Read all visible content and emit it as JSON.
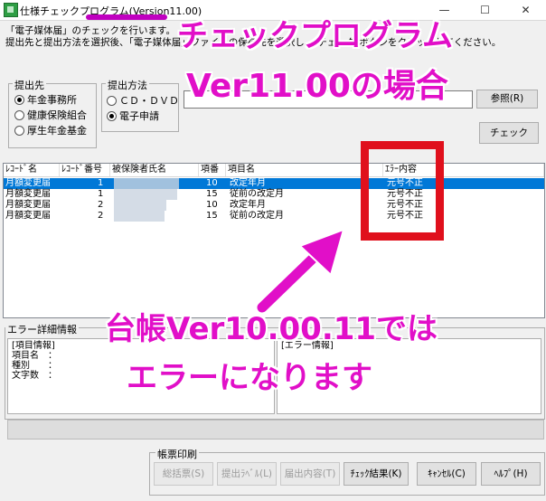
{
  "window": {
    "title": "仕様チェックプログラム(Version11.00)",
    "minimize": "—",
    "maximize": "☐",
    "close": "✕"
  },
  "instructions": {
    "line1": "「電子媒体届」のチェックを行います。",
    "line2": "提出先と提出方法を選択後、「電子媒体届」ファイルの保存先を選択し、[チェック]ボタンをクリックしてください。"
  },
  "submit_to": {
    "label": "提出先",
    "options": [
      "年金事務所",
      "健康保険組合",
      "厚生年金基金"
    ],
    "selected": 0
  },
  "method": {
    "label": "提出方法",
    "options": [
      "ＣＤ・ＤＶＤ",
      "電子申請"
    ],
    "selected": 1
  },
  "path": {
    "value": ""
  },
  "buttons": {
    "browse": "参照(R)",
    "check": "チェック"
  },
  "table": {
    "columns": [
      "ﾚｺｰﾄﾞ名",
      "ﾚｺｰﾄﾞ番号",
      "被保険者氏名",
      "項番",
      "項目名",
      "ｴﾗｰ内容"
    ],
    "rows": [
      {
        "record": "月額変更届",
        "no": "1",
        "name": "",
        "item_no": "10",
        "item": "改定年月",
        "error": "元号不正"
      },
      {
        "record": "月額変更届",
        "no": "1",
        "name": "",
        "item_no": "15",
        "item": "従前の改定月",
        "error": "元号不正"
      },
      {
        "record": "月額変更届",
        "no": "2",
        "name": "",
        "item_no": "10",
        "item": "改定年月",
        "error": "元号不正"
      },
      {
        "record": "月額変更届",
        "no": "2",
        "name": "",
        "item_no": "15",
        "item": "従前の改定月",
        "error": "元号不正"
      }
    ],
    "selected_row": 0
  },
  "error_detail": {
    "label": "エラー詳細情報",
    "item_info_title": "[項目情報]",
    "item_info_lines": [
      "項目名　：",
      "種別　　：",
      "文字数　："
    ],
    "error_info_title": "[エラー情報]"
  },
  "print": {
    "label": "帳票印刷",
    "buttons": [
      "総括票(S)",
      "提出ﾗﾍﾞﾙ(L)",
      "届出内容(T)",
      "ﾁｪｯｸ結果(K)"
    ]
  },
  "footer_buttons": {
    "cancel": "ｷｬﾝｾﾙ(C)",
    "help": "ﾍﾙﾌﾟ(H)"
  },
  "annotations": {
    "heading_line1": "チェックプログラム",
    "heading_line2": "Ver11.00の場合",
    "note_line1": "台帳Ver10.00.11では",
    "note_line2": "エラーになります",
    "color": "#e10fc8",
    "highlight_color": "#e0101c"
  }
}
